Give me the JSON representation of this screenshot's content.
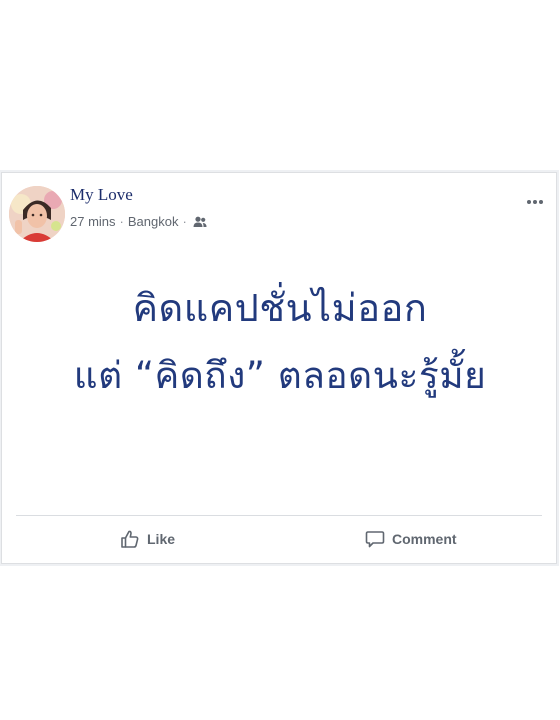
{
  "post": {
    "author_name": "My Love",
    "time": "27 mins",
    "separator": "·",
    "location": "Bangkok",
    "audience_icon": "friends-icon",
    "more_icon": "more-horizontal-icon",
    "text_line1": "คิดแคปชั่นไม่ออก",
    "text_line2": "แต่ “คิดถึง” ตลอดนะรู้มั้ย"
  },
  "actions": {
    "like_label": "Like",
    "like_icon": "thumbs-up-icon",
    "comment_label": "Comment",
    "comment_icon": "comment-bubble-icon"
  },
  "colors": {
    "author": "#1c2d6b",
    "post_text": "#223a7d",
    "meta": "#616770",
    "action": "#606770",
    "border": "#dddfe2"
  }
}
